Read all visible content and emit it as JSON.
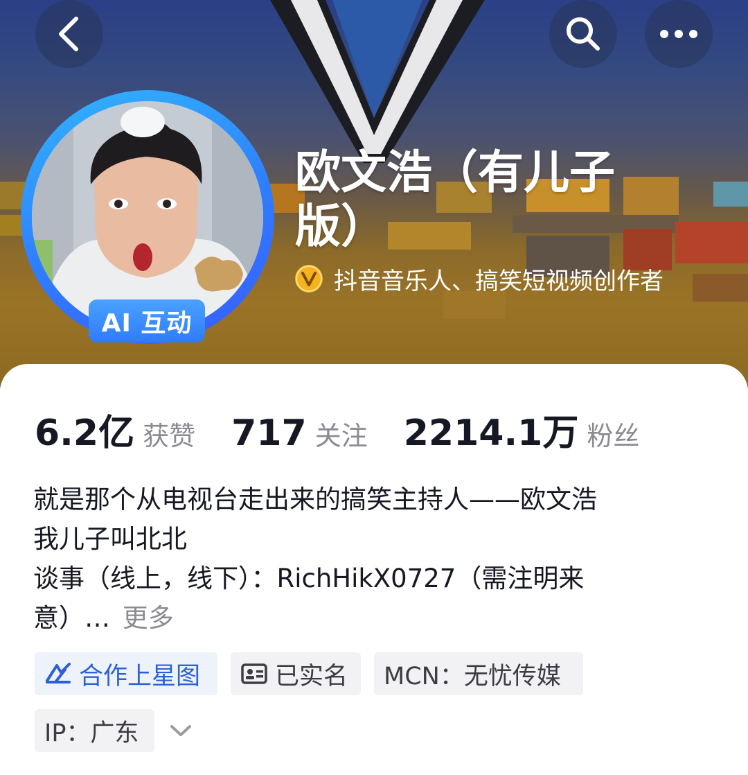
{
  "header": {
    "back_icon": "chevron-left-icon",
    "search_icon": "search-icon",
    "more_icon": "more-dots-icon"
  },
  "profile": {
    "name_line1": "欧文浩（有儿子",
    "name_line2": "版）",
    "ai_badge": "AI 互动",
    "verify_icon": "verified-v-icon",
    "verify_text": "抖音音乐人、搞笑短视频创作者"
  },
  "stats": {
    "likes_value": "6.2亿",
    "likes_label": "获赞",
    "following_value": "717",
    "following_label": "关注",
    "followers_value": "2214.1万",
    "followers_label": "粉丝"
  },
  "bio": {
    "line1": "就是那个从电视台走出来的搞笑主持人——欧文浩",
    "line2": "我儿子叫北北",
    "line3": "谈事（线上，线下）：RichHikX0727（需注明来",
    "line4": "意）…",
    "more": "更多"
  },
  "tags": {
    "cooperate": "合作上星图",
    "verified": "已实名",
    "mcn": "MCN：无忧传媒",
    "ip": "IP：广东"
  },
  "colors": {
    "accent_blue": "#2d5fd6",
    "verify_gold": "#f5b41f",
    "ai_badge_blue": "#2f7bff"
  }
}
